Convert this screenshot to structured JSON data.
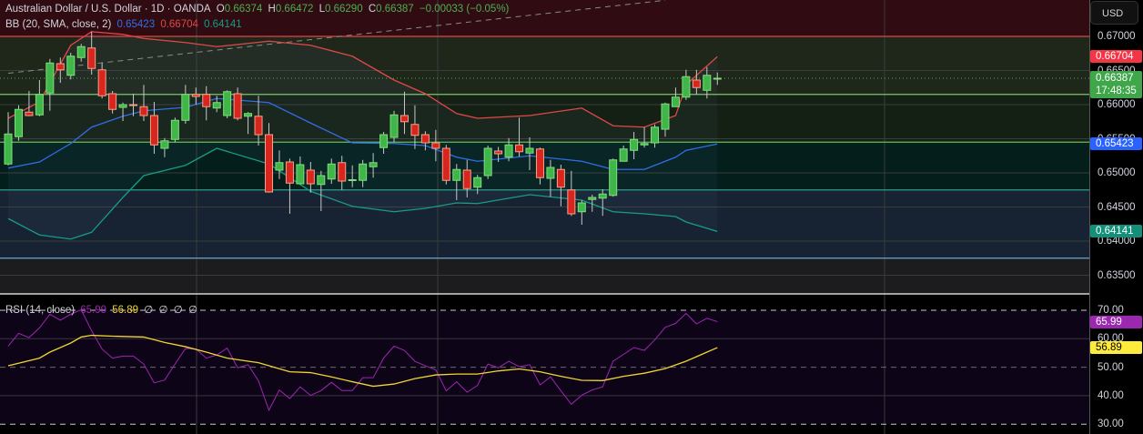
{
  "header": {
    "symbol": "Australian Dollar / U.S. Dollar · 1D · OANDA",
    "o_label": "O",
    "o": "0.66374",
    "h_label": "H",
    "h": "0.66472",
    "l_label": "L",
    "l": "0.66290",
    "c_label": "C",
    "c": "0.66387",
    "change": "−0.00033 (−0.05%)"
  },
  "bb_legend": {
    "label": "BB (20, SMA, close, 2)",
    "basis": "0.65423",
    "upper": "0.66704",
    "lower": "0.64141"
  },
  "rsi_legend": {
    "label": "RSI (14, close)",
    "rsi": "65.99",
    "ma": "56.89",
    "extra": [
      "∅",
      "∅",
      "∅",
      "∅"
    ]
  },
  "axis": {
    "currency": "USD",
    "price_ticks": [
      "0.67000",
      "0.66500",
      "0.66000",
      "0.65500",
      "0.65000",
      "0.64500",
      "0.64000",
      "0.63500"
    ],
    "rsi_ticks": [
      "70.00",
      "60.00",
      "50.00",
      "40.00",
      "30.00"
    ],
    "badges": {
      "upper": "0.66704",
      "last": "0.66387",
      "countdown": "17:48:35",
      "basis": "0.65423",
      "lower": "0.64141",
      "rsi": "65.99",
      "rsi_ma": "56.89"
    }
  },
  "colors": {
    "up": "#3fb54a",
    "down": "#d8261f",
    "upper": "#e04848",
    "basis": "#2f6ee8",
    "lower": "#179c85",
    "rsi": "#9c27b0",
    "rsi_ma": "#f0d630"
  },
  "chart_data": {
    "type": "candlestick",
    "title": "Australian Dollar / U.S. Dollar · 1D · OANDA",
    "ylim": [
      0.6325,
      0.6753
    ],
    "candle_fields": [
      "open",
      "high",
      "low",
      "close"
    ],
    "candles": [
      [
        0.6513,
        0.6589,
        0.6511,
        0.6557
      ],
      [
        0.6553,
        0.6599,
        0.6547,
        0.6593
      ],
      [
        0.6589,
        0.662,
        0.6583,
        0.6584
      ],
      [
        0.6585,
        0.6636,
        0.6583,
        0.6615
      ],
      [
        0.6617,
        0.6667,
        0.6591,
        0.6661
      ],
      [
        0.666,
        0.6669,
        0.6632,
        0.6651
      ],
      [
        0.6643,
        0.6676,
        0.6637,
        0.6671
      ],
      [
        0.6669,
        0.6689,
        0.6663,
        0.6685
      ],
      [
        0.6683,
        0.6707,
        0.6644,
        0.6653
      ],
      [
        0.6651,
        0.6661,
        0.6609,
        0.6613
      ],
      [
        0.6616,
        0.662,
        0.6587,
        0.6593
      ],
      [
        0.6596,
        0.6603,
        0.6576,
        0.66
      ],
      [
        0.66,
        0.6616,
        0.6583,
        0.6599
      ],
      [
        0.6597,
        0.6629,
        0.6576,
        0.6584
      ],
      [
        0.6584,
        0.6604,
        0.6528,
        0.6541
      ],
      [
        0.6536,
        0.6551,
        0.6523,
        0.6547
      ],
      [
        0.6549,
        0.6581,
        0.6545,
        0.6577
      ],
      [
        0.6577,
        0.6629,
        0.6572,
        0.6615
      ],
      [
        0.6615,
        0.6625,
        0.66,
        0.6612
      ],
      [
        0.6615,
        0.6627,
        0.6577,
        0.6597
      ],
      [
        0.6595,
        0.6613,
        0.6589,
        0.6603
      ],
      [
        0.6584,
        0.6621,
        0.658,
        0.6619
      ],
      [
        0.6616,
        0.6625,
        0.6577,
        0.658
      ],
      [
        0.6583,
        0.6589,
        0.6557,
        0.6587
      ],
      [
        0.6583,
        0.6613,
        0.654,
        0.6556
      ],
      [
        0.6556,
        0.6573,
        0.6471,
        0.6472
      ],
      [
        0.6504,
        0.6533,
        0.6491,
        0.6515
      ],
      [
        0.6516,
        0.6521,
        0.644,
        0.6485
      ],
      [
        0.6484,
        0.6524,
        0.6484,
        0.6512
      ],
      [
        0.6504,
        0.6516,
        0.6471,
        0.6484
      ],
      [
        0.6483,
        0.6503,
        0.6444,
        0.6496
      ],
      [
        0.6491,
        0.6521,
        0.6484,
        0.6513
      ],
      [
        0.6515,
        0.6525,
        0.6475,
        0.6488
      ],
      [
        0.6489,
        0.6511,
        0.6479,
        0.649
      ],
      [
        0.6489,
        0.6519,
        0.6479,
        0.6513
      ],
      [
        0.6509,
        0.6529,
        0.6493,
        0.6515
      ],
      [
        0.6537,
        0.656,
        0.6528,
        0.6556
      ],
      [
        0.6552,
        0.6591,
        0.6545,
        0.6585
      ],
      [
        0.6584,
        0.6619,
        0.6557,
        0.6575
      ],
      [
        0.6571,
        0.6599,
        0.6535,
        0.6555
      ],
      [
        0.6556,
        0.6561,
        0.6533,
        0.6544
      ],
      [
        0.6544,
        0.6563,
        0.6517,
        0.6536
      ],
      [
        0.6536,
        0.6541,
        0.6483,
        0.6489
      ],
      [
        0.6489,
        0.6513,
        0.646,
        0.6505
      ],
      [
        0.6504,
        0.6519,
        0.6464,
        0.6477
      ],
      [
        0.6479,
        0.6497,
        0.6469,
        0.6493
      ],
      [
        0.6496,
        0.654,
        0.6491,
        0.6536
      ],
      [
        0.6532,
        0.6538,
        0.6516,
        0.6528
      ],
      [
        0.6523,
        0.6551,
        0.6517,
        0.6541
      ],
      [
        0.6541,
        0.6581,
        0.6524,
        0.6531
      ],
      [
        0.6529,
        0.6552,
        0.6504,
        0.6536
      ],
      [
        0.6535,
        0.6537,
        0.6483,
        0.6493
      ],
      [
        0.6492,
        0.6519,
        0.6465,
        0.6508
      ],
      [
        0.6505,
        0.6512,
        0.6451,
        0.6479
      ],
      [
        0.6475,
        0.6503,
        0.6437,
        0.644
      ],
      [
        0.6443,
        0.646,
        0.6424,
        0.6456
      ],
      [
        0.6461,
        0.6468,
        0.6443,
        0.6464
      ],
      [
        0.6463,
        0.6476,
        0.6437,
        0.6469
      ],
      [
        0.6467,
        0.6521,
        0.6465,
        0.6519
      ],
      [
        0.6517,
        0.654,
        0.6517,
        0.6535
      ],
      [
        0.6533,
        0.656,
        0.652,
        0.6549
      ],
      [
        0.6541,
        0.6567,
        0.6537,
        0.6543
      ],
      [
        0.6544,
        0.6571,
        0.6537,
        0.6567
      ],
      [
        0.6564,
        0.6603,
        0.6553,
        0.6601
      ],
      [
        0.6597,
        0.6625,
        0.6597,
        0.6611
      ],
      [
        0.6611,
        0.6651,
        0.6607,
        0.6641
      ],
      [
        0.6636,
        0.6651,
        0.6615,
        0.6625
      ],
      [
        0.6621,
        0.6655,
        0.6609,
        0.6643
      ],
      [
        0.66374,
        0.66472,
        0.6629,
        0.66387
      ]
    ],
    "bollinger_fields": [
      "index",
      "upper",
      "basis",
      "lower"
    ],
    "bollinger": [
      [
        0,
        0.658,
        0.6507,
        0.6433
      ],
      [
        3,
        0.6604,
        0.6516,
        0.6409
      ],
      [
        6,
        0.6687,
        0.6543,
        0.6403
      ],
      [
        8,
        0.6707,
        0.6567,
        0.6413
      ],
      [
        11,
        0.6703,
        0.6583,
        0.6464
      ],
      [
        13,
        0.6697,
        0.6591,
        0.6496
      ],
      [
        17,
        0.6691,
        0.6596,
        0.6511
      ],
      [
        20,
        0.6685,
        0.6609,
        0.6536
      ],
      [
        25,
        0.6693,
        0.6603,
        0.6513
      ],
      [
        29,
        0.6687,
        0.6573,
        0.6473
      ],
      [
        33,
        0.6671,
        0.6544,
        0.6451
      ],
      [
        37,
        0.6636,
        0.6543,
        0.6443
      ],
      [
        40,
        0.6616,
        0.654,
        0.6448
      ],
      [
        43,
        0.6587,
        0.6523,
        0.6456
      ],
      [
        45,
        0.658,
        0.6517,
        0.6455
      ],
      [
        50,
        0.6584,
        0.6525,
        0.6468
      ],
      [
        55,
        0.6595,
        0.6517,
        0.646
      ],
      [
        58,
        0.6569,
        0.6505,
        0.6443
      ],
      [
        61,
        0.6567,
        0.6505,
        0.644
      ],
      [
        64,
        0.6584,
        0.6523,
        0.6436
      ],
      [
        65,
        0.6629,
        0.6533,
        0.6428
      ],
      [
        68,
        0.66704,
        0.65423,
        0.64141
      ]
    ],
    "levels": [
      0.67,
      0.6615,
      0.6545,
      0.6475,
      0.6375
    ],
    "trendline": [
      [
        0,
        0.6646
      ],
      [
        63,
        0.6753
      ]
    ],
    "rsi": {
      "ylim": [
        30,
        70
      ],
      "levels": [
        70,
        60,
        50,
        40,
        30
      ],
      "values": [
        57.4,
        61.9,
        60.4,
        63.8,
        68.6,
        66.5,
        68.6,
        70.2,
        62.8,
        56.4,
        53.2,
        53.9,
        53.9,
        51.1,
        44.5,
        45.5,
        51.1,
        56.6,
        56.4,
        53.2,
        54.3,
        56.7,
        49.8,
        50.9,
        45.2,
        34.9,
        42.0,
        39.0,
        43.1,
        40.1,
        41.8,
        44.7,
        41.8,
        41.8,
        46.3,
        46.3,
        53.2,
        57.4,
        55.9,
        52.1,
        50.5,
        49.1,
        41.7,
        44.9,
        41.2,
        43.6,
        51.1,
        49.8,
        52.1,
        50.2,
        50.9,
        43.8,
        46.6,
        41.7,
        37.0,
        40.2,
        42.0,
        43.1,
        52.1,
        54.5,
        56.9,
        55.9,
        59.6,
        64.0,
        65.4,
        68.9,
        65.2,
        67.2,
        65.99
      ],
      "ma_points": [
        [
          0,
          50.5
        ],
        [
          3,
          53.2
        ],
        [
          4,
          55.3
        ],
        [
          6,
          58.5
        ],
        [
          7,
          60.6
        ],
        [
          8,
          61.2
        ],
        [
          10,
          60.9
        ],
        [
          13,
          60.6
        ],
        [
          15,
          58.7
        ],
        [
          17,
          57.2
        ],
        [
          19,
          55.3
        ],
        [
          21,
          53.2
        ],
        [
          23,
          52.1
        ],
        [
          24,
          51.6
        ],
        [
          27,
          48.4
        ],
        [
          29,
          48.1
        ],
        [
          31,
          46.6
        ],
        [
          33,
          44.9
        ],
        [
          35,
          43.3
        ],
        [
          37,
          44.1
        ],
        [
          39,
          46.0
        ],
        [
          41,
          47.3
        ],
        [
          43,
          47.6
        ],
        [
          45,
          47.6
        ],
        [
          47,
          48.7
        ],
        [
          49,
          49.4
        ],
        [
          51,
          48.4
        ],
        [
          53,
          46.8
        ],
        [
          55,
          45.4
        ],
        [
          57,
          45.3
        ],
        [
          59,
          46.8
        ],
        [
          61,
          47.9
        ],
        [
          63,
          49.5
        ],
        [
          65,
          52.1
        ],
        [
          67,
          55.3
        ],
        [
          68,
          56.89
        ]
      ]
    }
  }
}
